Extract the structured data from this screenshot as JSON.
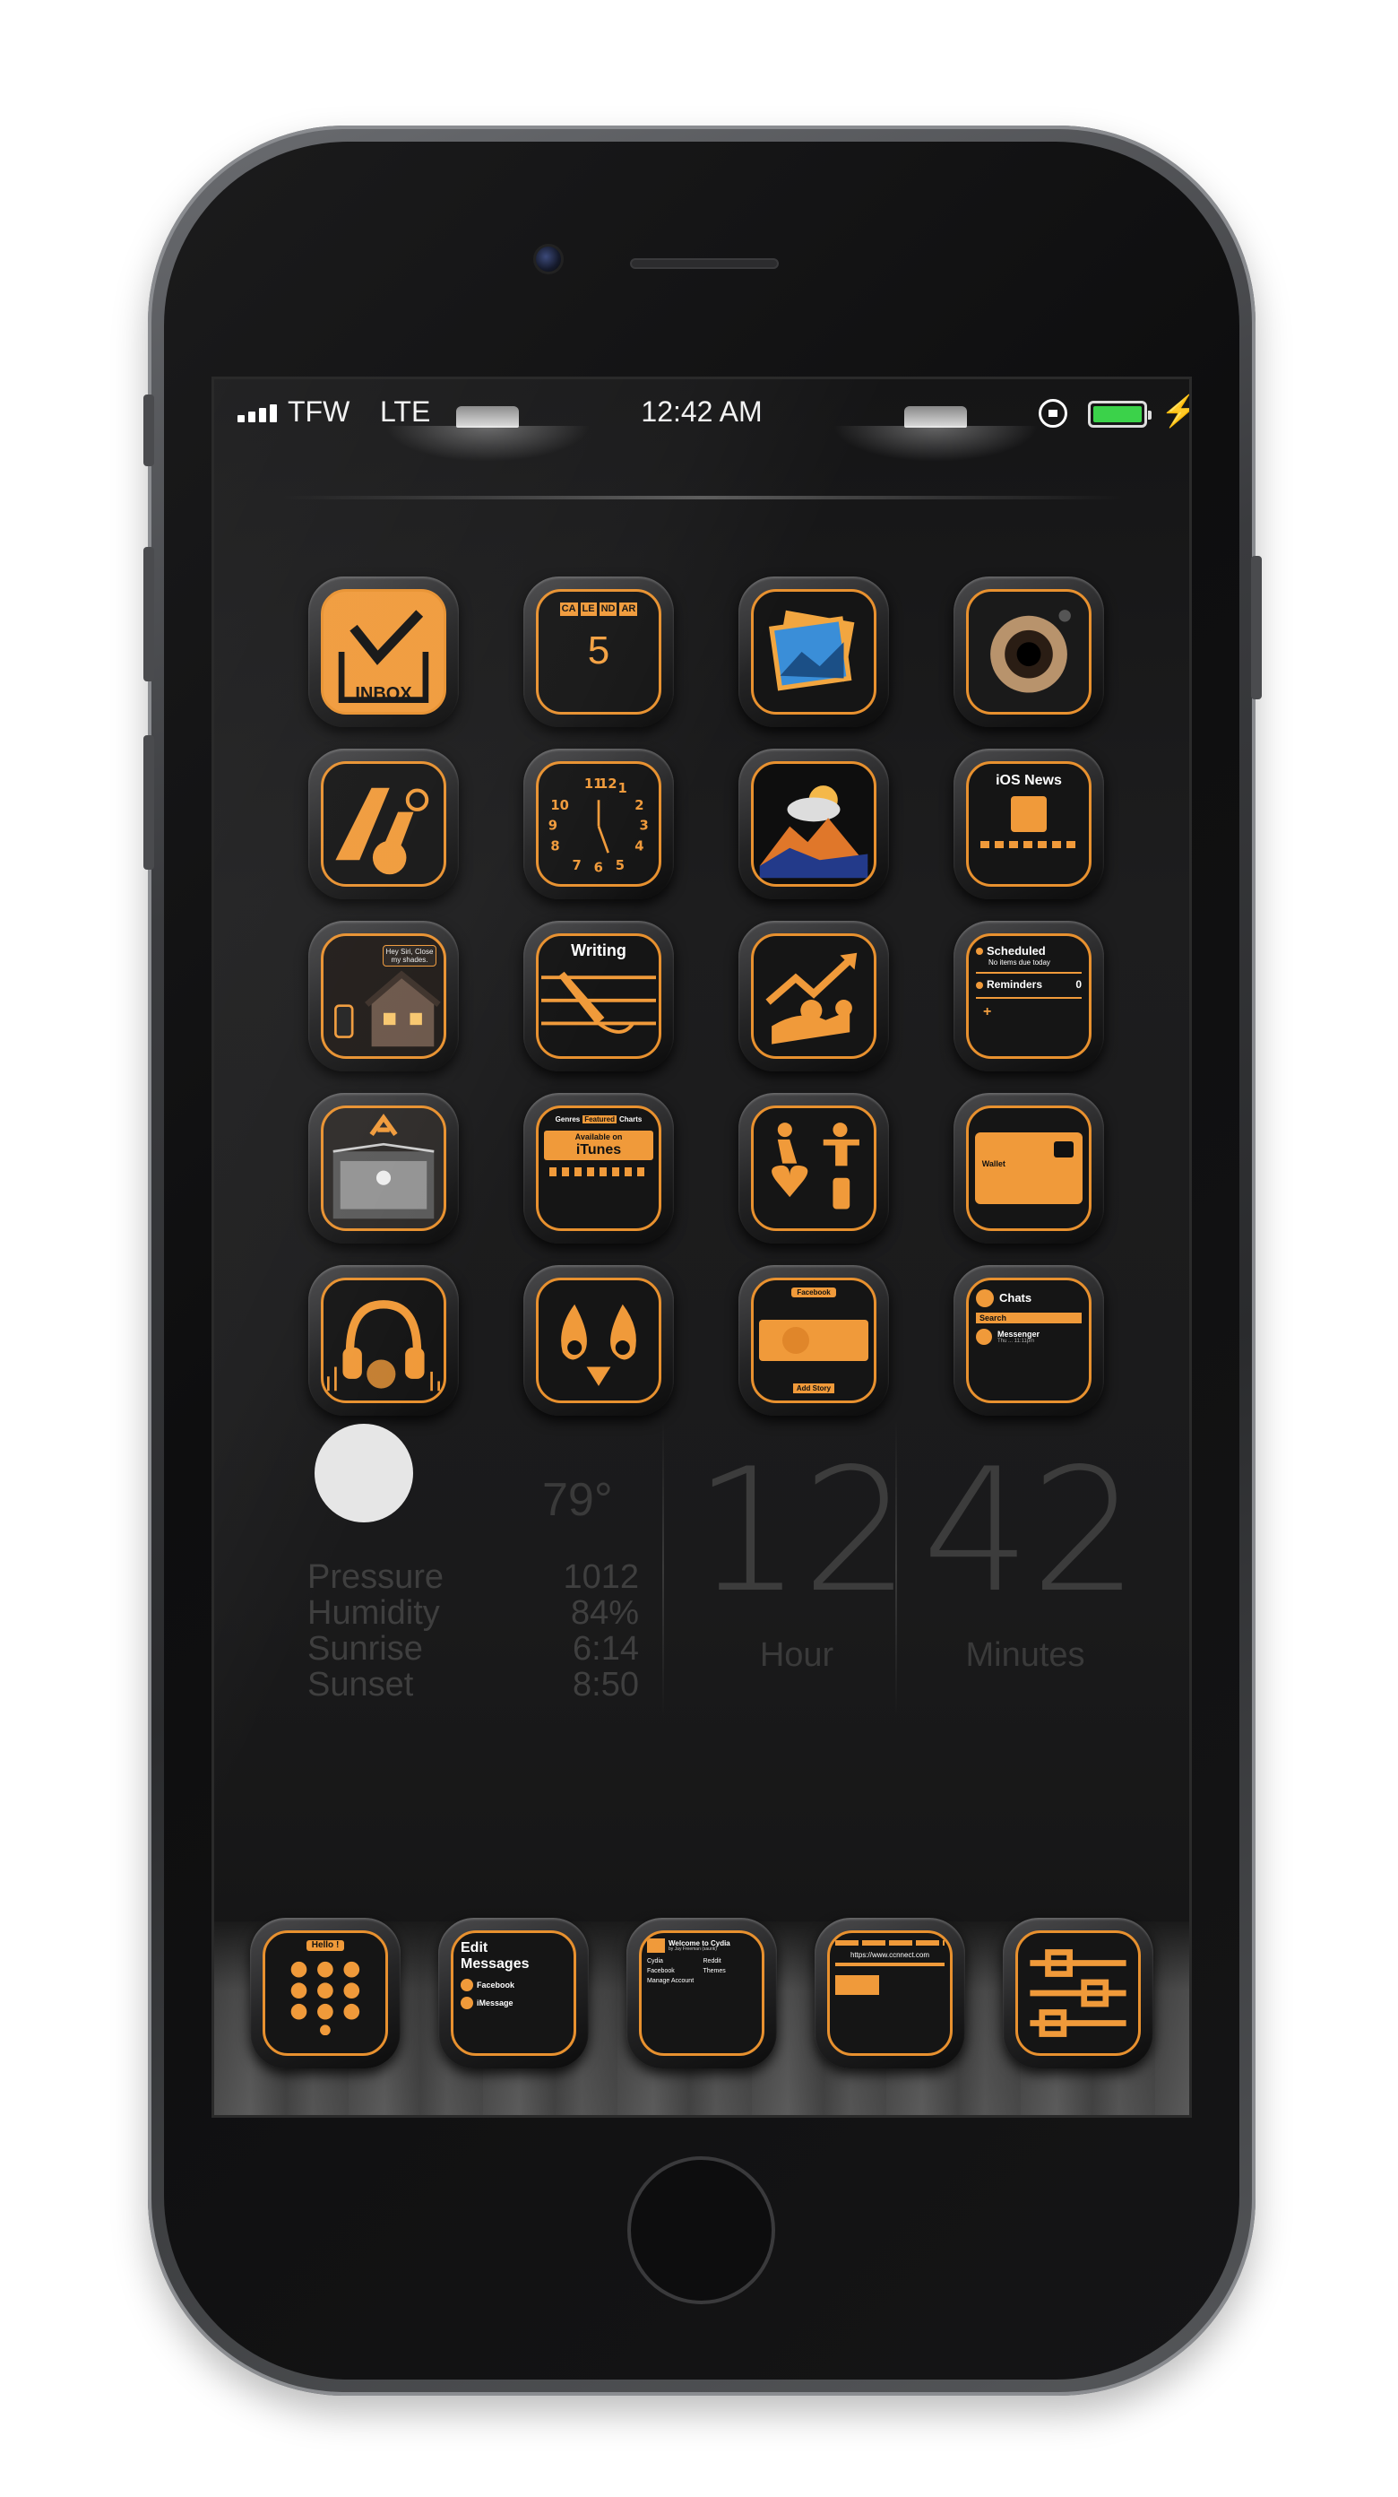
{
  "status_bar": {
    "carrier": "TFW",
    "network": "LTE",
    "time": "12:42 AM",
    "battery_color": "#3bd24a"
  },
  "home_icons": [
    {
      "name": "inbox-app",
      "label": "INBOX"
    },
    {
      "name": "calendar-app",
      "days": [
        "CA",
        "LE",
        "ND",
        "AR"
      ],
      "date": "5"
    },
    {
      "name": "photos-app",
      "label": ""
    },
    {
      "name": "camera-app",
      "label": ""
    },
    {
      "name": "maps-app",
      "label": ""
    },
    {
      "name": "clock-app",
      "numbers": [
        "11",
        "12",
        "1",
        "2",
        "10",
        "3",
        "9",
        "4",
        "8",
        "7",
        "6",
        "5"
      ]
    },
    {
      "name": "weather-app",
      "label": ""
    },
    {
      "name": "news-app",
      "label": "iOS News"
    },
    {
      "name": "home-app",
      "label": "Hey Siri, Close my shades."
    },
    {
      "name": "writing-app",
      "label": "Writing"
    },
    {
      "name": "stocks-app",
      "label": ""
    },
    {
      "name": "reminders-app",
      "scheduled": "Scheduled",
      "no_items": "No items due today",
      "reminders": "Reminders",
      "count": "0",
      "plus": "+"
    },
    {
      "name": "app-store-app",
      "label": ""
    },
    {
      "name": "itunes-app",
      "tabs": [
        "Genres",
        "Featured",
        "Charts"
      ],
      "available": "Available on",
      "brand": "iTunes"
    },
    {
      "name": "fitness-app",
      "label": ""
    },
    {
      "name": "wallet-app",
      "label": "Wallet"
    },
    {
      "name": "music-app",
      "label": ""
    },
    {
      "name": "tinder-app",
      "label": ""
    },
    {
      "name": "facebook-app",
      "top": "Facebook",
      "add_story": "Add Story"
    },
    {
      "name": "messenger-app",
      "chats": "Chats",
      "search": "Search",
      "messenger": "Messenger",
      "sub": "Thu ... 11:11pm"
    }
  ],
  "weather": {
    "temperature": "79°",
    "rows": [
      {
        "label": "Pressure",
        "value": "1012"
      },
      {
        "label": "Humidity",
        "value": "84%"
      },
      {
        "label": "Sunrise",
        "value": "6:14"
      },
      {
        "label": "Sunset",
        "value": "8:50"
      }
    ]
  },
  "clock_widget": {
    "hour": "12",
    "hour_label": "Hour",
    "minutes": "42",
    "minutes_label": "Minutes"
  },
  "dock": [
    {
      "name": "phone-app",
      "label": "Hello !"
    },
    {
      "name": "messages-app",
      "title_line1": "Edit",
      "title_line2": "Messages",
      "item1": "Facebook",
      "item2": "iMessage"
    },
    {
      "name": "cydia-app",
      "title": "Welcome to Cydia",
      "sub": "by Jay Freeman (saurik)",
      "items": [
        "Cydia",
        "Reddit",
        "Facebook",
        "Themes",
        "Manage Account"
      ]
    },
    {
      "name": "safari-app",
      "url": "https://www.ccnnect.com"
    },
    {
      "name": "settings-app",
      "label": ""
    }
  ],
  "accent_color": "#e8912f"
}
